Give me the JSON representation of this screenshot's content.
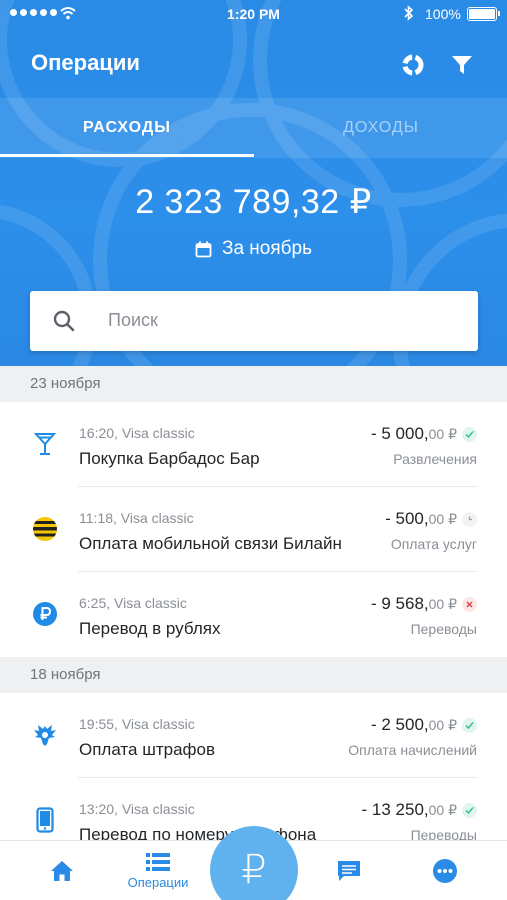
{
  "status_bar": {
    "time": "1:20 PM",
    "battery": "100%"
  },
  "header": {
    "title": "Операции",
    "tabs": [
      {
        "label": "РАСХОДЫ",
        "active": true
      },
      {
        "label": "ДОХОДЫ",
        "active": false
      }
    ],
    "total": "2 323 789,32 ₽",
    "period": "За ноябрь"
  },
  "search": {
    "placeholder": "Поиск"
  },
  "groups": [
    {
      "date": "23 ноября",
      "operations": [
        {
          "meta": "16:20, Visa classic",
          "name": "Покупка Барбадос Бар",
          "amount": "- 5 000,",
          "kopecks": "00 ₽",
          "category": "Развлечения",
          "status": "success",
          "icon": "cocktail-icon"
        },
        {
          "meta": "11:18, Visa classic",
          "name": "Оплата мобильной связи Билайн",
          "amount": "- 500,",
          "kopecks": "00 ₽",
          "category": "Оплата услуг",
          "status": "pending",
          "icon": "beeline-logo-icon"
        },
        {
          "meta": "6:25, Visa classic",
          "name": "Перевод в рублях",
          "amount": "- 9 568,",
          "kopecks": "00 ₽",
          "category": "Переводы",
          "status": "failed",
          "icon": "ruble-icon"
        }
      ]
    },
    {
      "date": "18 ноября",
      "operations": [
        {
          "meta": "19:55, Visa classic",
          "name": "Оплата штрафов",
          "amount": "- 2 500,",
          "kopecks": "00 ₽",
          "category": "Оплата начислений",
          "status": "success",
          "icon": "eagle-emblem-icon"
        },
        {
          "meta": "13:20, Visa classic",
          "name": "Перевод по номеру телефона",
          "amount": "- 13 250,",
          "kopecks": "00 ₽",
          "category": "Переводы",
          "status": "success",
          "icon": "phone-icon"
        }
      ]
    }
  ],
  "tabbar": {
    "items": [
      {
        "label": "",
        "icon": "home-icon"
      },
      {
        "label": "Операции",
        "icon": "list-icon"
      },
      {
        "label": "",
        "icon": "ruble-icon"
      },
      {
        "label": "",
        "icon": "chat-icon"
      },
      {
        "label": "",
        "icon": "more-icon"
      }
    ],
    "fab_symbol": "₽"
  },
  "colors": {
    "primary": "#2a8be6",
    "fab": "#5fb2ee",
    "success": "#39c08f",
    "error": "#e5484d"
  }
}
